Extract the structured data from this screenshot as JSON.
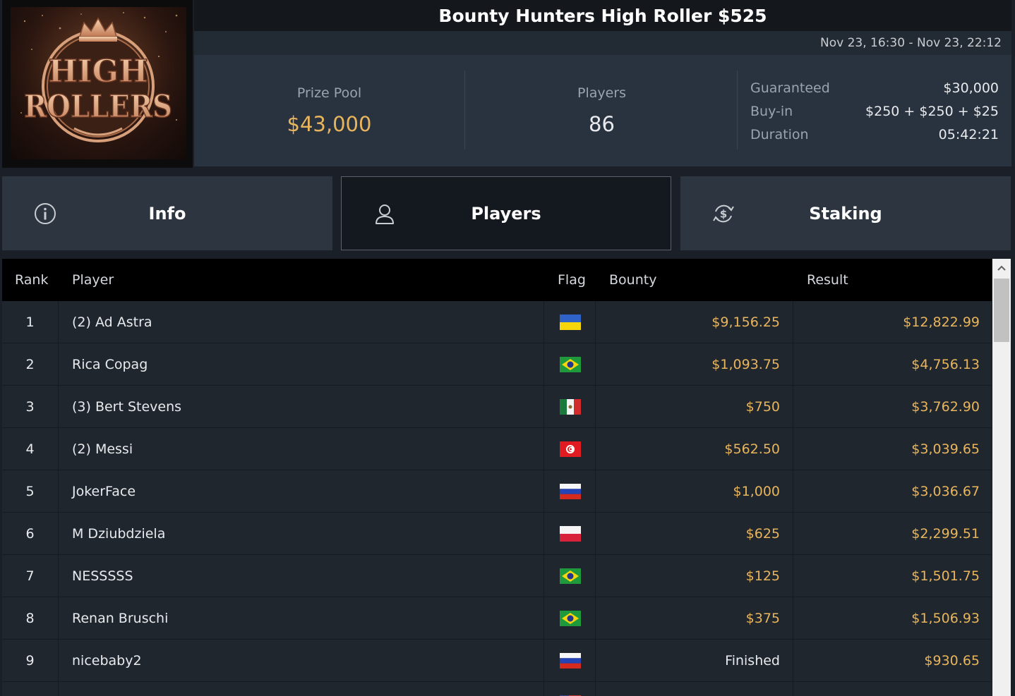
{
  "logo": {
    "line1": "HIGH",
    "line2": "ROLLERS"
  },
  "header": {
    "title": "Bounty Hunters High Roller $525",
    "dates": "Nov 23, 16:30 - Nov 23, 22:12"
  },
  "stats": {
    "prize_pool_label": "Prize Pool",
    "prize_pool_value": "$43,000",
    "players_label": "Players",
    "players_value": "86",
    "guaranteed_label": "Guaranteed",
    "guaranteed_value": "$30,000",
    "buyin_label": "Buy-in",
    "buyin_value": "$250 + $250 + $25",
    "duration_label": "Duration",
    "duration_value": "05:42:21"
  },
  "tabs": {
    "info": "Info",
    "players": "Players",
    "staking": "Staking",
    "active": "players"
  },
  "table": {
    "headers": {
      "rank": "Rank",
      "player": "Player",
      "flag": "Flag",
      "bounty": "Bounty",
      "result": "Result"
    },
    "rows": [
      {
        "rank": "1",
        "player": "(2) Ad Astra",
        "flag": "ukraine",
        "bounty": "$9,156.25",
        "result": "$12,822.99"
      },
      {
        "rank": "2",
        "player": "Rica Copag",
        "flag": "brazil",
        "bounty": "$1,093.75",
        "result": "$4,756.13"
      },
      {
        "rank": "3",
        "player": "(3) Bert Stevens",
        "flag": "mexico",
        "bounty": "$750",
        "result": "$3,762.90"
      },
      {
        "rank": "4",
        "player": "(2) Messi",
        "flag": "tunisia",
        "bounty": "$562.50",
        "result": "$3,039.65"
      },
      {
        "rank": "5",
        "player": "JokerFace",
        "flag": "russia",
        "bounty": "$1,000",
        "result": "$3,036.67"
      },
      {
        "rank": "6",
        "player": "M Dziubdziela",
        "flag": "poland",
        "bounty": "$625",
        "result": "$2,299.51"
      },
      {
        "rank": "7",
        "player": "NESSSSS",
        "flag": "brazil",
        "bounty": "$125",
        "result": "$1,501.75"
      },
      {
        "rank": "8",
        "player": "Renan Bruschi",
        "flag": "brazil",
        "bounty": "$375",
        "result": "$1,506.93"
      },
      {
        "rank": "9",
        "player": "nicebaby2",
        "flag": "russia",
        "bounty": "Finished",
        "result": "$930.65"
      },
      {
        "rank": "",
        "player": "",
        "flag": "usa",
        "bounty": "",
        "result": ""
      }
    ]
  },
  "colors": {
    "accent_gold": "#e8b55d",
    "header_bg": "#14181d",
    "stats_bg": "#293340",
    "row_bg": "#1f262e"
  }
}
